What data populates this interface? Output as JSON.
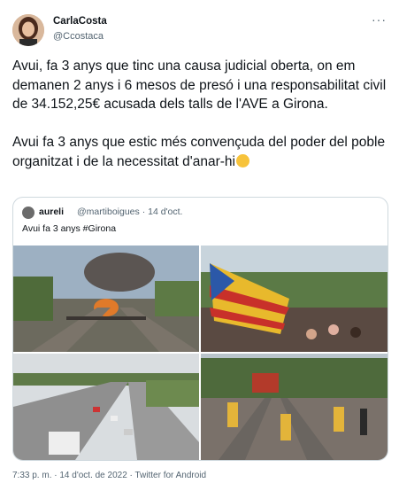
{
  "author": {
    "name": "CarlaCosta",
    "handle": "@Ccostaca"
  },
  "more_label": "···",
  "tweet": {
    "paragraph1": "Avui, fa 3 anys que tinc una causa judicial oberta, on em demanen 2 anys i 6 mesos de presó i una responsabilitat civil de 34.152,25€ acusada dels talls de l'AVE a Girona.",
    "paragraph2": "Avui fa 3 anys que estic més convençuda del poder del poble organitzat i de la necessitat d'anar-hi"
  },
  "quoted": {
    "name": "aureli",
    "meta": "@martiboigues · 14 d'oct.",
    "text": "Avui fa 3 anys #Girona"
  },
  "footer": "7:33 p. m. · 14 d'oct. de 2022 · Twitter for Android",
  "icons": {
    "fist": "raised-fist-emoji",
    "more": "more-icon"
  },
  "colors": {
    "text": "#0f1419",
    "muted": "#536471",
    "border": "#cfd9de"
  }
}
